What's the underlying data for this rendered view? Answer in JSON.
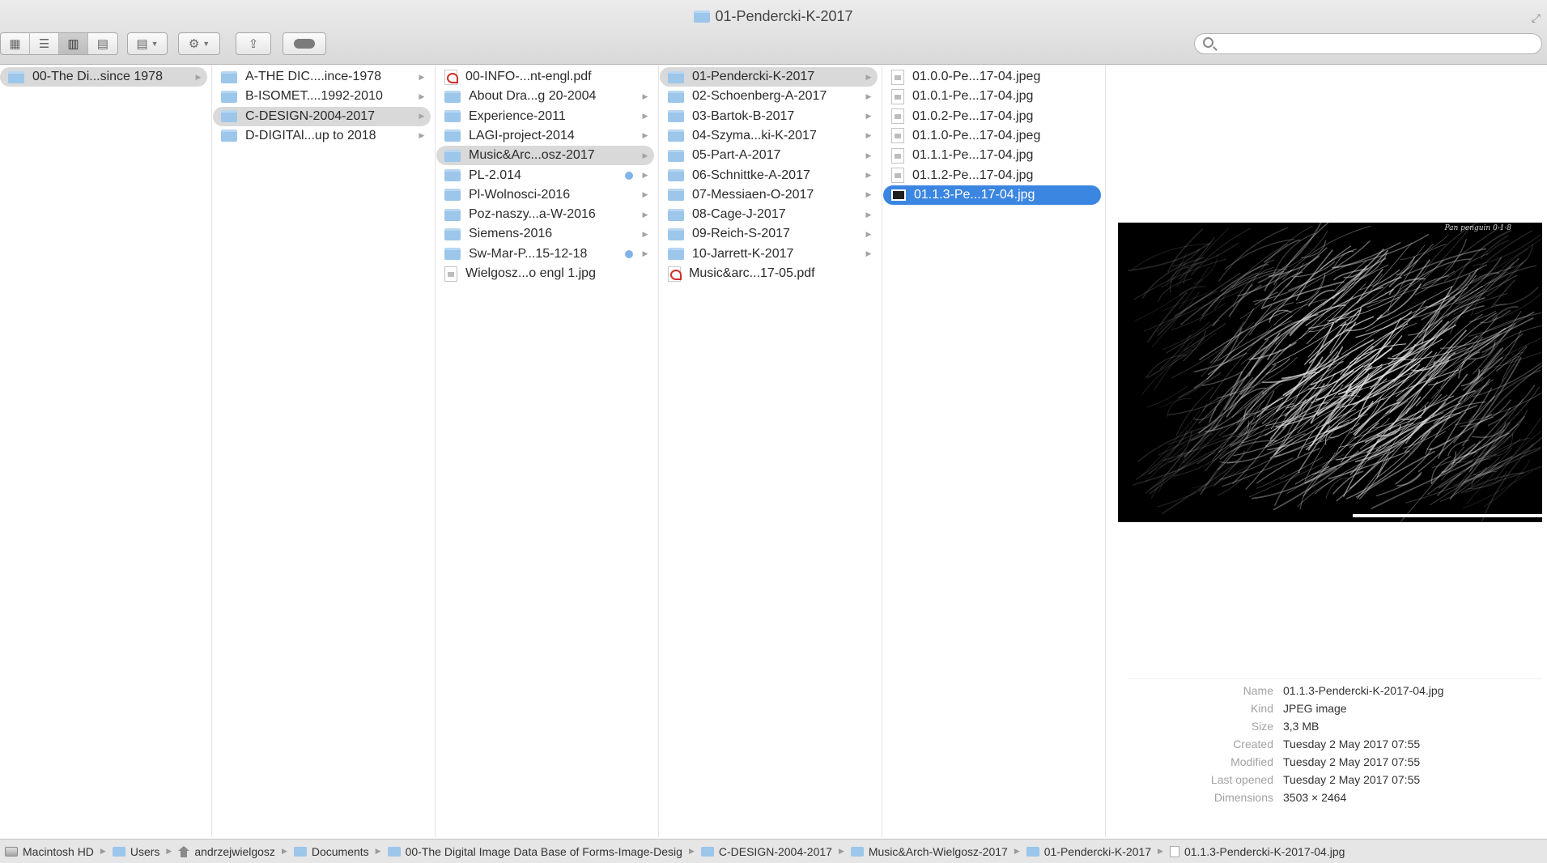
{
  "window": {
    "title": "01-Pendercki-K-2017"
  },
  "toolbar": {
    "view_modes": [
      "icon-view",
      "list-view",
      "column-view",
      "cover-flow-view"
    ],
    "active_view": "column-view",
    "arrange_icon": "arrange-icon",
    "action_icon": "gear-icon",
    "share_icon": "share-icon",
    "tags_icon": "tag-icon"
  },
  "search": {
    "value": "",
    "placeholder": ""
  },
  "columns": [
    {
      "items": [
        {
          "label": "00-The Di...since 1978",
          "type": "folder",
          "state": "grey",
          "arrow": true
        }
      ]
    },
    {
      "items": [
        {
          "label": "A-THE DIC....ince-1978",
          "type": "folder",
          "arrow": true
        },
        {
          "label": "B-ISOMET....1992-2010",
          "type": "folder",
          "arrow": true
        },
        {
          "label": "C-DESIGN-2004-2017",
          "type": "folder",
          "state": "grey",
          "arrow": true
        },
        {
          "label": "D-DIGITAl...up to 2018",
          "type": "folder",
          "arrow": true
        }
      ]
    },
    {
      "items": [
        {
          "label": "00-INFO-...nt-engl.pdf",
          "type": "pdf"
        },
        {
          "label": "About Dra...g 20-2004",
          "type": "folder",
          "arrow": true
        },
        {
          "label": "Experience-2011",
          "type": "folder",
          "arrow": true
        },
        {
          "label": "LAGI-project-2014",
          "type": "folder",
          "arrow": true
        },
        {
          "label": "Music&Arc...osz-2017",
          "type": "folder",
          "state": "grey",
          "arrow": true
        },
        {
          "label": "PL-2.014",
          "type": "folder",
          "tag": true,
          "arrow": true
        },
        {
          "label": "Pl-Wolnosci-2016",
          "type": "folder",
          "arrow": true
        },
        {
          "label": "Poz-naszy...a-W-2016",
          "type": "folder",
          "arrow": true
        },
        {
          "label": "Siemens-2016",
          "type": "folder",
          "arrow": true
        },
        {
          "label": "Sw-Mar-P...15-12-18",
          "type": "folder",
          "tag": true,
          "arrow": true
        },
        {
          "label": "Wielgosz...o engl 1.jpg",
          "type": "img"
        }
      ]
    },
    {
      "items": [
        {
          "label": "01-Pendercki-K-2017",
          "type": "folder",
          "state": "grey",
          "arrow": true
        },
        {
          "label": "02-Schoenberg-A-2017",
          "type": "folder",
          "arrow": true
        },
        {
          "label": "03-Bartok-B-2017",
          "type": "folder",
          "arrow": true
        },
        {
          "label": "04-Szyma...ki-K-2017",
          "type": "folder",
          "arrow": true
        },
        {
          "label": "05-Part-A-2017",
          "type": "folder",
          "arrow": true
        },
        {
          "label": "06-Schnittke-A-2017",
          "type": "folder",
          "arrow": true
        },
        {
          "label": "07-Messiaen-O-2017",
          "type": "folder",
          "arrow": true
        },
        {
          "label": "08-Cage-J-2017",
          "type": "folder",
          "arrow": true
        },
        {
          "label": "09-Reich-S-2017",
          "type": "folder",
          "arrow": true
        },
        {
          "label": "10-Jarrett-K-2017",
          "type": "folder",
          "arrow": true
        },
        {
          "label": "Music&arc...17-05.pdf",
          "type": "pdf"
        }
      ]
    },
    {
      "items": [
        {
          "label": "01.0.0-Pe...17-04.jpeg",
          "type": "img"
        },
        {
          "label": "01.0.1-Pe...17-04.jpg",
          "type": "img"
        },
        {
          "label": "01.0.2-Pe...17-04.jpg",
          "type": "img"
        },
        {
          "label": "01.1.0-Pe...17-04.jpeg",
          "type": "img"
        },
        {
          "label": "01.1.1-Pe...17-04.jpg",
          "type": "img"
        },
        {
          "label": "01.1.2-Pe...17-04.jpg",
          "type": "img"
        },
        {
          "label": "01.1.3-Pe...17-04.jpg",
          "type": "img-dark",
          "state": "blue"
        }
      ]
    }
  ],
  "preview": {
    "corner_text": "Pan penguin 0·1·8",
    "info": [
      {
        "key": "Name",
        "value": "01.1.3-Pendercki-K-2017-04.jpg"
      },
      {
        "key": "Kind",
        "value": "JPEG image"
      },
      {
        "key": "Size",
        "value": "3,3 MB"
      },
      {
        "key": "Created",
        "value": "Tuesday 2 May 2017 07:55"
      },
      {
        "key": "Modified",
        "value": "Tuesday 2 May 2017 07:55"
      },
      {
        "key": "Last opened",
        "value": "Tuesday 2 May 2017 07:55"
      },
      {
        "key": "Dimensions",
        "value": "3503 × 2464"
      }
    ]
  },
  "pathbar": [
    {
      "label": "Macintosh HD",
      "icon": "disk"
    },
    {
      "label": "Users",
      "icon": "folder"
    },
    {
      "label": "andrzejwielgosz",
      "icon": "home"
    },
    {
      "label": "Documents",
      "icon": "folder"
    },
    {
      "label": "00-The Digital Image Data Base of Forms-Image-Desig",
      "icon": "folder"
    },
    {
      "label": "C-DESIGN-2004-2017",
      "icon": "folder"
    },
    {
      "label": "Music&Arch-Wielgosz-2017",
      "icon": "folder"
    },
    {
      "label": "01-Pendercki-K-2017",
      "icon": "folder"
    },
    {
      "label": "01.1.3-Pendercki-K-2017-04.jpg",
      "icon": "file"
    }
  ]
}
